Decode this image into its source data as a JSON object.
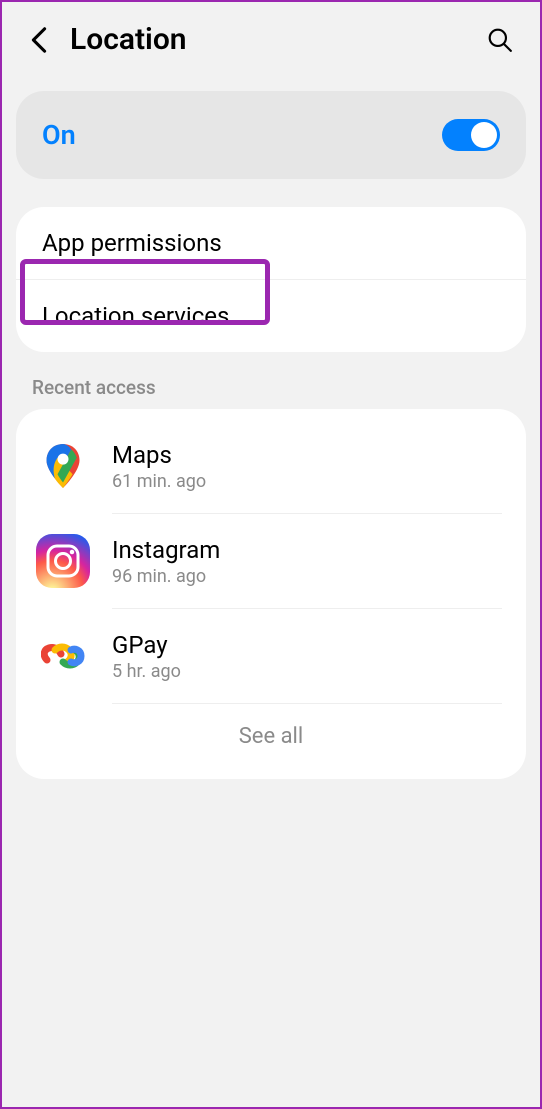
{
  "header": {
    "title": "Location"
  },
  "toggle": {
    "label": "On",
    "enabled": true
  },
  "menu": {
    "app_permissions": "App permissions",
    "location_services": "Location services"
  },
  "recent": {
    "header": "Recent access",
    "apps": [
      {
        "name": "Maps",
        "time": "61 min. ago"
      },
      {
        "name": "Instagram",
        "time": "96 min. ago"
      },
      {
        "name": "GPay",
        "time": "5 hr. ago"
      }
    ],
    "see_all": "See all"
  }
}
